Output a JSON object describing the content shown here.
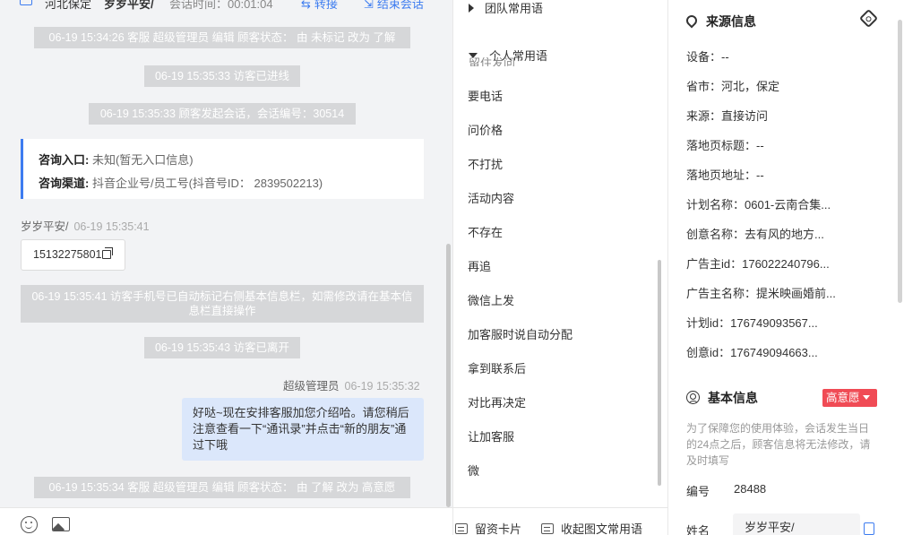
{
  "header": {
    "location": "河北保定",
    "visitor_name": "岁岁平安/",
    "session_time": "会话时间：00:01:04",
    "transfer_label": "转接",
    "end_label": "结束会话"
  },
  "chat": {
    "messages": {
      "sys1": "06-19 15:34:26 客服 超级管理员 编辑 顾客状态： 由 未标记 改为 了解",
      "sys2": "06-19 15:35:33 访客已进线",
      "sys3": "06-19 15:35:33 顾客发起会话，会话编号：30514",
      "entry_label": "咨询入口:",
      "entry_value": " 未知(暂无入口信息)",
      "channel_label": "咨询渠道:",
      "channel_value": " 抖音企业号/员工号(抖音号ID： 2839502213)",
      "visitor_name": "岁岁平安/",
      "visitor_time": "06-19 15:35:41",
      "phone": "15132275801",
      "sys4": "06-19 15:35:41 访客手机号已自动标记右侧基本信息栏，如需修改请在基本信息栏直接操作",
      "sys5": "06-19 15:35:43 访客已离开",
      "agent_name": "超级管理员",
      "agent_time": "06-19 15:35:32",
      "agent_text": "好哒~现在安排客服加您介绍哈。请您稍后注意查看一下“通讯录”并点击“新的朋友”通过下哦",
      "sys6": "06-19 15:35:34 客服 超级管理员 编辑 顾客状态： 由 了解 改为 高意愿"
    }
  },
  "quick_replies": {
    "group_team": "团队常用语",
    "group_personal": "个人常用语",
    "clipped_item": "留住发问",
    "items": [
      "要电话",
      "问价格",
      "不打扰",
      "活动内容",
      "不存在",
      "再追",
      "微信上发",
      "加客服时说自动分配",
      "拿到联系后",
      "对比再决定",
      "让加客服",
      "微"
    ],
    "footer_card": "留资卡片",
    "footer_collapse": "收起图文常用语"
  },
  "info": {
    "source_title": "来源信息",
    "source_fields": [
      "设备：--",
      "省市：河北，保定",
      "来源：直接访问",
      "落地页标题：--",
      "落地页地址：--",
      "计划名称：0601-云南合集...",
      "创意名称：去有风的地方...",
      "广告主id：176022240796...",
      "广告主名称：提米映画婚前...",
      "计划id：176749093567...",
      "创意id：176749094663..."
    ],
    "basic_title": "基本信息",
    "intent_label": "高意愿",
    "notice": "为了保障您的使用体验，会话发生当日的24点之后，顾客信息将无法修改，请及时填写",
    "number_label": "编号",
    "number_value": "28488",
    "name_label": "姓名",
    "name_value": "岁岁平安/"
  },
  "colors": {
    "accent": "#3d7cf0",
    "system_message_bg": "#d6d7d9",
    "agent_bubble_bg": "#dbe7fb",
    "intent_badge": "#f04b55"
  }
}
